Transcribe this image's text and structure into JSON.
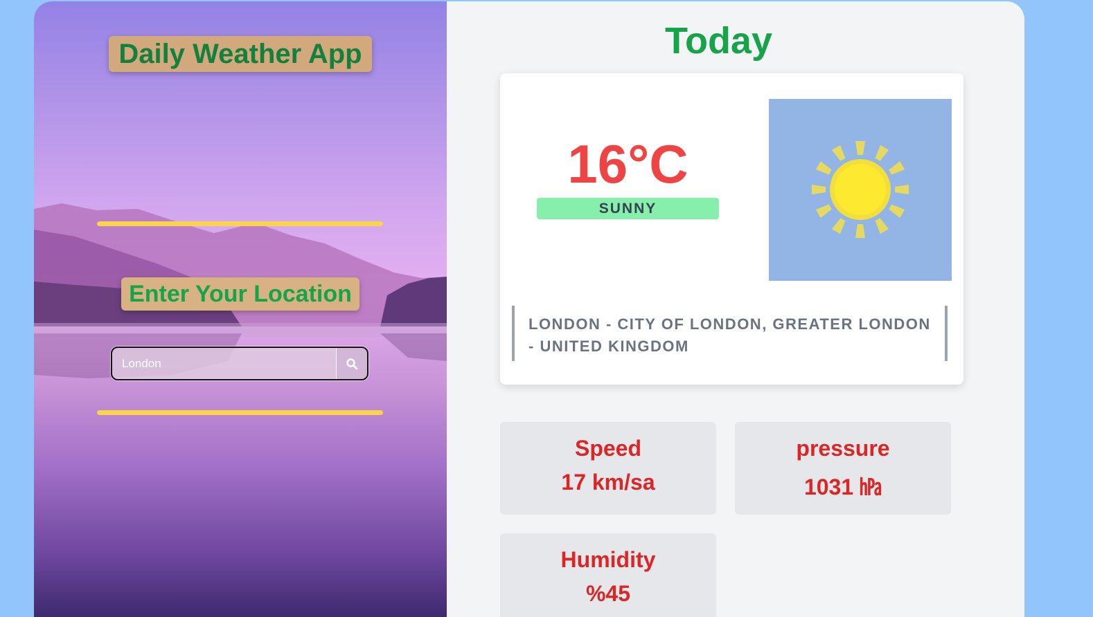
{
  "app": {
    "title": "Daily Weather App",
    "location_prompt": "Enter Your Location",
    "search": {
      "value": "London",
      "icon": "search-icon"
    }
  },
  "today": {
    "heading": "Today",
    "temperature": "16°C",
    "condition": "SUNNY",
    "image_icon": "sun-icon",
    "location": "LONDON - CITY OF LONDON, GREATER LONDON - UNITED KINGDOM"
  },
  "stats": [
    {
      "label": "Speed",
      "value": "17 km/sa"
    },
    {
      "label": "pressure",
      "value": "1031 ㍱"
    },
    {
      "label": "Humidity",
      "value": "%45"
    }
  ],
  "colors": {
    "accent_green": "#16a34a",
    "temperature_red": "#ef4444",
    "divider_yellow": "#fcd34d",
    "condition_badge": "#86efac"
  }
}
